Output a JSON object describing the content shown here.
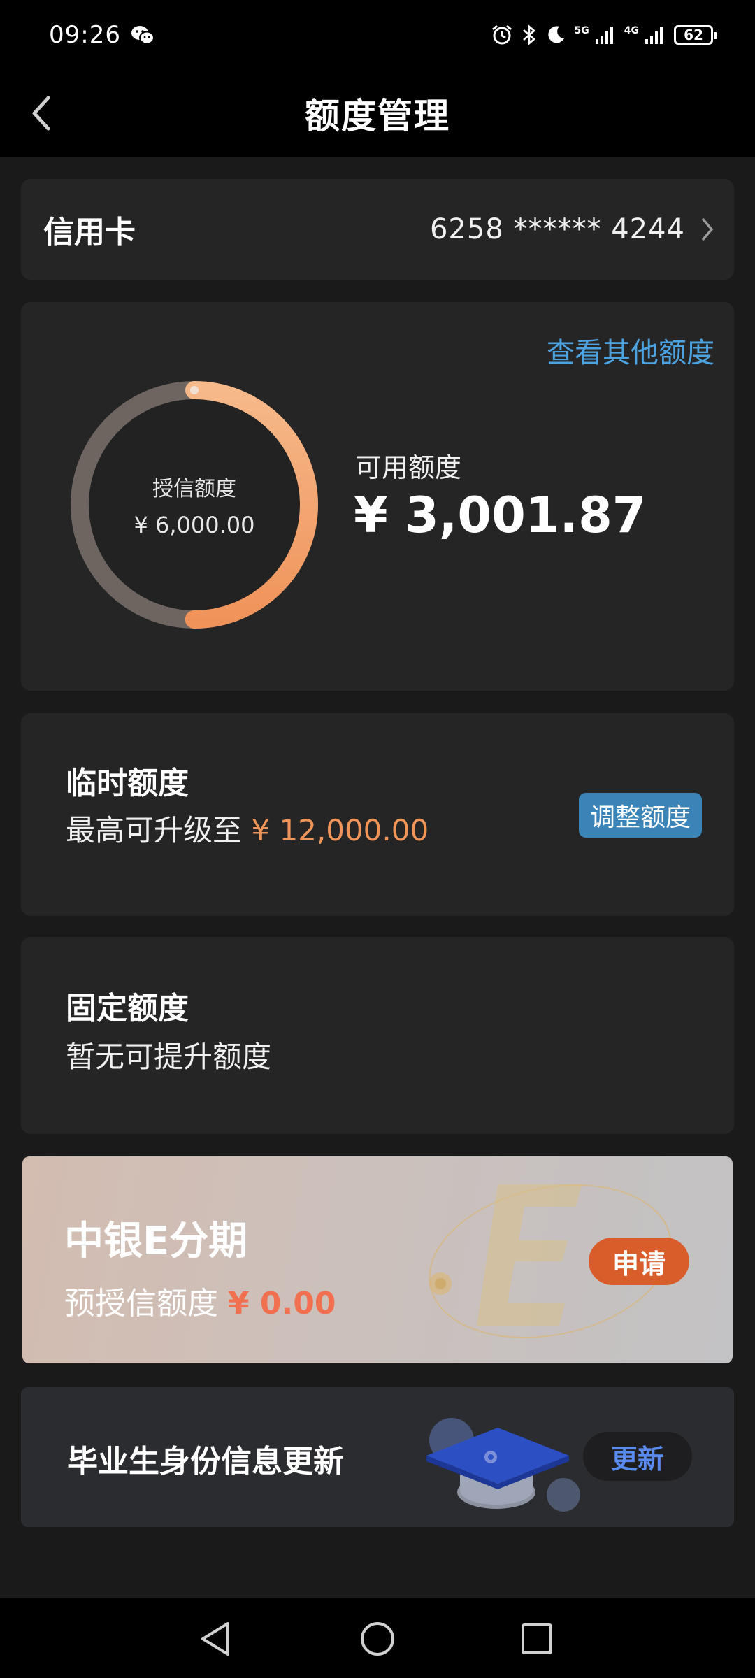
{
  "status_bar": {
    "time": "09:26",
    "network_1": "5G",
    "network_2": "4G",
    "battery": "62"
  },
  "header": {
    "title": "额度管理"
  },
  "credit_card": {
    "label": "信用卡",
    "number": "6258 ****** 4244"
  },
  "quota": {
    "view_other": "查看其他额度",
    "ring_label": "授信额度",
    "ring_amount": "¥ 6,000.00",
    "available_label": "可用额度",
    "available_amount": "¥ 3,001.87",
    "available_ratio": 0.5003
  },
  "temporary": {
    "title": "临时额度",
    "desc_prefix": "最高可升级至",
    "desc_amount": "¥ 12,000.00",
    "button": "调整额度"
  },
  "fixed": {
    "title": "固定额度",
    "desc": "暂无可提升额度"
  },
  "e_installment": {
    "title": "中银E分期",
    "desc_prefix": "预授信额度",
    "desc_amount": "¥ 0.00",
    "button": "申请"
  },
  "graduate": {
    "title": "毕业生身份信息更新",
    "button": "更新"
  },
  "colors": {
    "accent_blue": "#4da3e0",
    "orange": "#f0955a",
    "apply_orange": "#d85d2a",
    "update_blue": "#5a8cf0"
  }
}
